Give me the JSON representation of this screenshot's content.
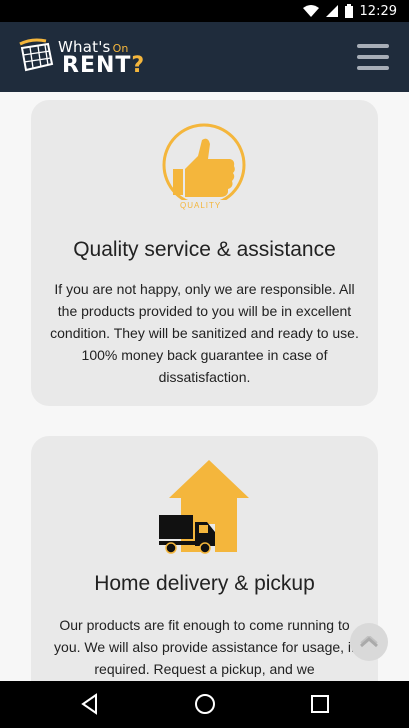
{
  "status_bar": {
    "time": "12:29"
  },
  "header": {
    "logo_top": "What's",
    "logo_on": "On",
    "logo_rent": "RENT",
    "logo_mark": "?"
  },
  "cards": [
    {
      "icon": "thumbs-up-quality-icon",
      "icon_text": "QUALITY",
      "title": "Quality service & assistance",
      "body": "If you are not happy, only we are responsible. All the products provided to you will be in excellent condition. They will be sanitized and ready to use. 100% money back guarantee in case of dissatisfaction."
    },
    {
      "icon": "house-truck-icon",
      "title": "Home delivery & pickup",
      "body": "Our products are fit enough to come running to you. We will also provide assistance for usage, if required. Request a pickup, and we"
    }
  ],
  "colors": {
    "accent": "#f4b63c",
    "header_bg": "#1f2c3c",
    "card_bg": "#e9e9e9"
  }
}
